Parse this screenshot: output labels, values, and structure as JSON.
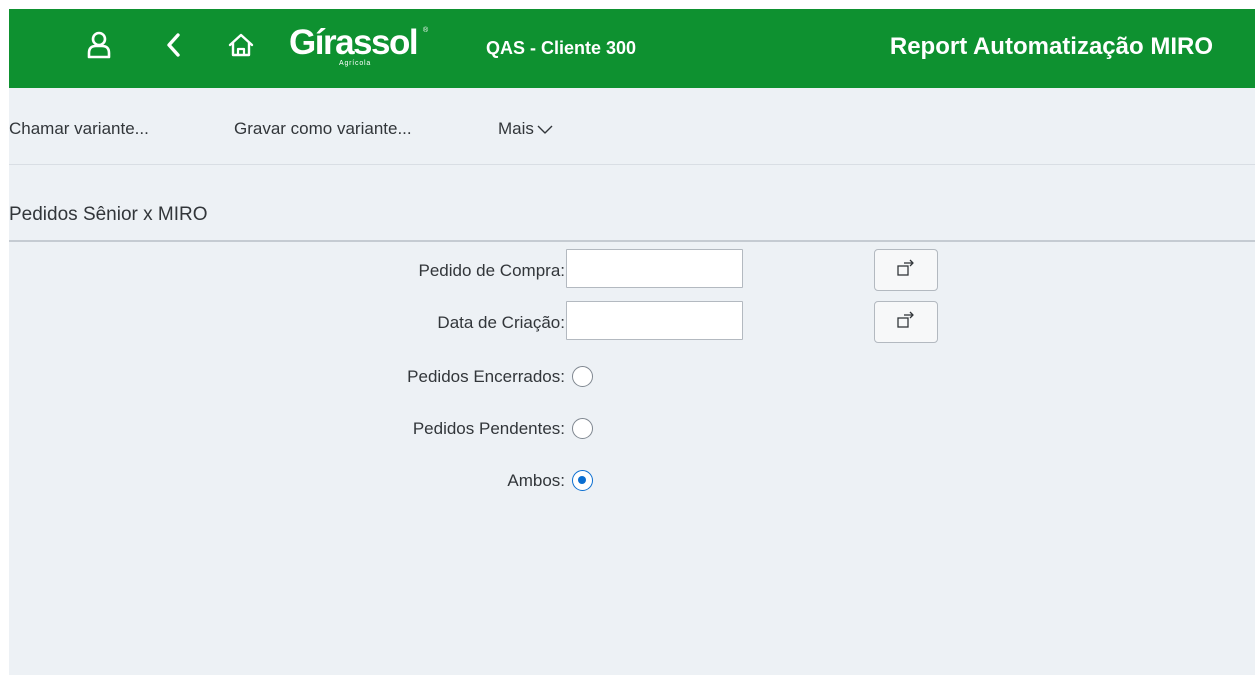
{
  "header": {
    "logo_text": "Gírassol",
    "logo_subtext": "Agrícola",
    "logo_mark": "®",
    "system": "QAS - Cliente 300",
    "title": "Report Automatização MIRO",
    "icons": {
      "user": "user-icon",
      "back": "back-icon",
      "home": "home-icon"
    }
  },
  "toolbar": {
    "get_variant": "Chamar variante...",
    "save_variant": "Gravar como variante...",
    "more": "Mais"
  },
  "section": {
    "title": "Pedidos Sênior x MIRO"
  },
  "form": {
    "purchase_order": {
      "label": "Pedido de Compra:",
      "value": "",
      "placeholder": ""
    },
    "creation_date": {
      "label": "Data de Criação:",
      "value": "",
      "placeholder": ""
    },
    "radios": [
      {
        "label": "Pedidos Encerrados:",
        "selected": false
      },
      {
        "label": "Pedidos Pendentes:",
        "selected": false
      },
      {
        "label": "Ambos:",
        "selected": true
      }
    ]
  },
  "colors": {
    "shell_green": "#0e9130",
    "background": "#edf1f5",
    "text": "#32363a",
    "radio_selected": "#0a6ed1"
  }
}
